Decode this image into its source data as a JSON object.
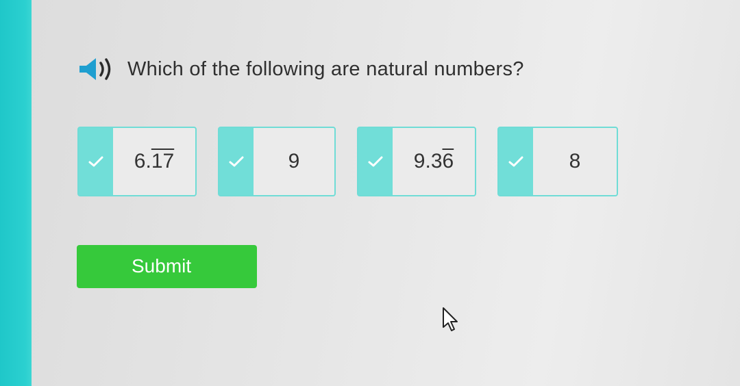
{
  "question": {
    "text": "Which of the following are natural numbers?",
    "audio_icon": "speaker-icon"
  },
  "choices": [
    {
      "value_int": "6.",
      "value_repeat": "17",
      "check_icon": "checkmark-icon"
    },
    {
      "value_int": "9",
      "value_repeat": "",
      "check_icon": "checkmark-icon"
    },
    {
      "value_int": "9.3",
      "value_repeat": "6",
      "check_icon": "checkmark-icon"
    },
    {
      "value_int": "8",
      "value_repeat": "",
      "check_icon": "checkmark-icon"
    }
  ],
  "submit": {
    "label": "Submit"
  },
  "colors": {
    "accent_teal": "#2bd0d0",
    "choice_check": "#71ded8",
    "submit_green": "#36c93b",
    "background": "#e6e6e6"
  }
}
